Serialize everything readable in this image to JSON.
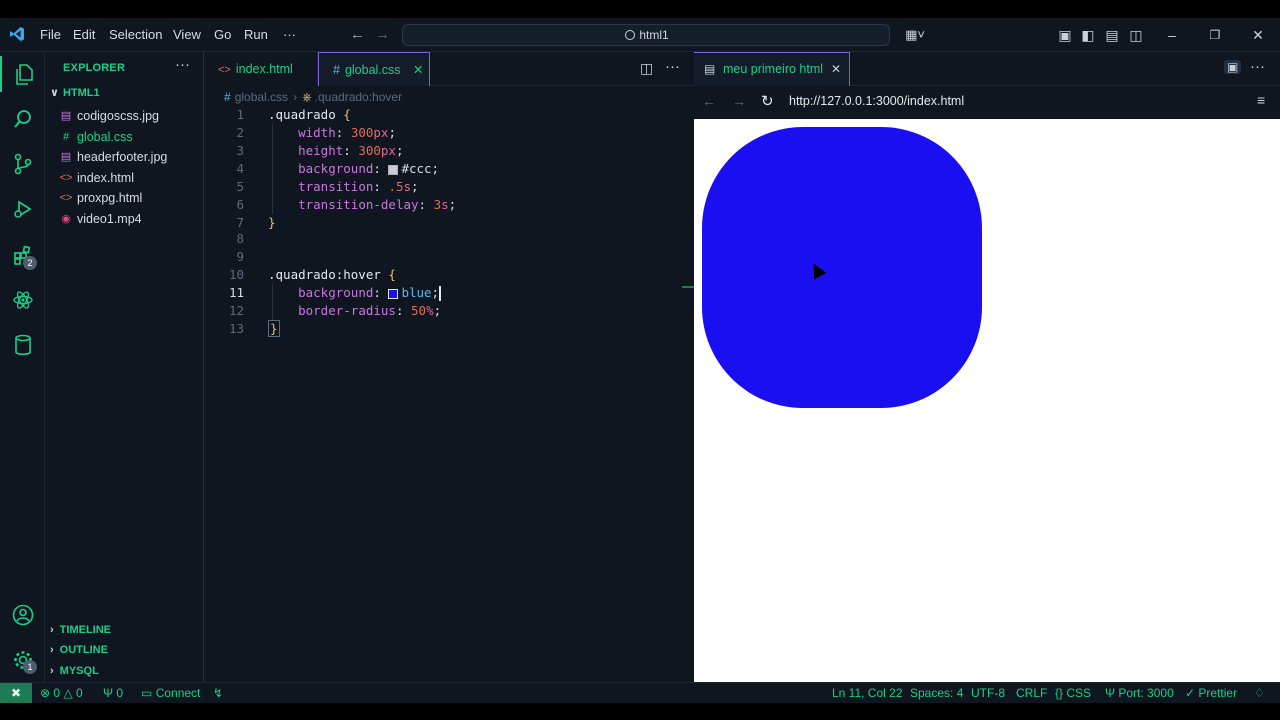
{
  "titlebar": {
    "menu": [
      "File",
      "Edit",
      "Selection",
      "View",
      "Go",
      "Run",
      "···"
    ],
    "search_text": "html1"
  },
  "activity": {
    "extensions_badge": "2",
    "settings_badge": "1"
  },
  "explorer": {
    "title": "EXPLORER",
    "folder": "HTML1",
    "files": [
      {
        "name": "codigoscss.jpg",
        "icon": "image-icon",
        "color": "#c678dd"
      },
      {
        "name": "global.css",
        "icon": "css-hash-icon",
        "color": "#19d089"
      },
      {
        "name": "headerfooter.jpg",
        "icon": "image-icon",
        "color": "#c678dd"
      },
      {
        "name": "index.html",
        "icon": "html-icon",
        "color": "#e06c5a"
      },
      {
        "name": "proxpg.html",
        "icon": "html-icon",
        "color": "#e06c5a"
      },
      {
        "name": "video1.mp4",
        "icon": "video-icon",
        "color": "#e0457b"
      }
    ],
    "sections": [
      "TIMELINE",
      "OUTLINE",
      "MYSQL"
    ]
  },
  "editor": {
    "tabs": [
      {
        "label": "index.html",
        "active": false
      },
      {
        "label": "global.css",
        "active": true
      }
    ],
    "breadcrumb": {
      "file": "global.css",
      "symbol": ".quadrado:hover"
    },
    "active_line": 11,
    "lines": [
      {
        "n": "1",
        "code": ".quadrado {"
      },
      {
        "n": "2",
        "code": "width: 300px;"
      },
      {
        "n": "3",
        "code": "height: 300px;"
      },
      {
        "n": "4",
        "code": "background: #ccc;"
      },
      {
        "n": "5",
        "code": "transition: .5s;"
      },
      {
        "n": "6",
        "code": "transition-delay: 3s;"
      },
      {
        "n": "7",
        "code": "}"
      },
      {
        "n": "8",
        "code": ""
      },
      {
        "n": "9",
        "code": ""
      },
      {
        "n": "10",
        "code": ".quadrado:hover {"
      },
      {
        "n": "11",
        "code": "background: blue;"
      },
      {
        "n": "12",
        "code": "border-radius: 50%;"
      },
      {
        "n": "13",
        "code": "}"
      }
    ]
  },
  "preview": {
    "tab_label": "meu primeiro html",
    "url": "http://127.0.0.1:3000/index.html",
    "square_color": "#1a0ff0"
  },
  "status": {
    "errors": "0",
    "warnings": "0",
    "ports": "0",
    "connect": "Connect",
    "position": "Ln 11, Col 22",
    "spaces": "Spaces: 4",
    "encoding": "UTF-8",
    "eol": "CRLF",
    "language": "CSS",
    "port": "Port: 3000",
    "formatter": "Prettier"
  },
  "colors": {
    "accent": "#19d089",
    "background": "#0f1620",
    "tab_border": "#7b63d6"
  }
}
